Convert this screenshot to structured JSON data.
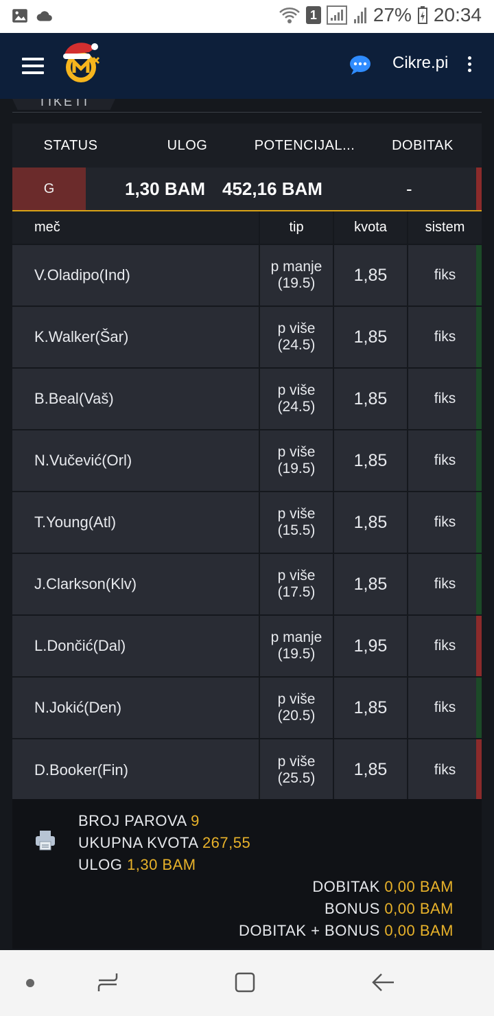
{
  "status_bar": {
    "battery": "27%",
    "time": "20:34",
    "sim_badge": "1"
  },
  "header": {
    "username": "Cikre.pi",
    "icons": [
      "menu-icon",
      "logo",
      "chat-icon",
      "more-vert-icon"
    ]
  },
  "tab": {
    "label": "TIKETI"
  },
  "ticket_header": {
    "status": "STATUS",
    "ulog": "ULOG",
    "potencijalni": "POTENCIJAL...",
    "dobitak": "DOBITAK"
  },
  "ticket": {
    "status": "G",
    "ulog": "1,30 BAM",
    "potencijalni": "452,16 BAM",
    "dobitak": "-",
    "status_color": "#6b2b2b",
    "accent_color": "#d9a316"
  },
  "columns": {
    "mec": "meč",
    "tip": "tip",
    "kvota": "kvota",
    "sistem": "sistem"
  },
  "matches": [
    {
      "mec": "V.Oladipo(Ind)",
      "tip1": "p manje",
      "tip2": "(19.5)",
      "kvota": "1,85",
      "sistem": "fiks",
      "result": "green"
    },
    {
      "mec": "K.Walker(Šar)",
      "tip1": "p više",
      "tip2": "(24.5)",
      "kvota": "1,85",
      "sistem": "fiks",
      "result": "green"
    },
    {
      "mec": "B.Beal(Vaš)",
      "tip1": "p više",
      "tip2": "(24.5)",
      "kvota": "1,85",
      "sistem": "fiks",
      "result": "green"
    },
    {
      "mec": "N.Vučević(Orl)",
      "tip1": "p više",
      "tip2": "(19.5)",
      "kvota": "1,85",
      "sistem": "fiks",
      "result": "green"
    },
    {
      "mec": "T.Young(Atl)",
      "tip1": "p više",
      "tip2": "(15.5)",
      "kvota": "1,85",
      "sistem": "fiks",
      "result": "green"
    },
    {
      "mec": "J.Clarkson(Klv)",
      "tip1": "p više",
      "tip2": "(17.5)",
      "kvota": "1,85",
      "sistem": "fiks",
      "result": "green"
    },
    {
      "mec": "L.Dončić(Dal)",
      "tip1": "p manje",
      "tip2": "(19.5)",
      "kvota": "1,95",
      "sistem": "fiks",
      "result": "red"
    },
    {
      "mec": "N.Jokić(Den)",
      "tip1": "p više",
      "tip2": "(20.5)",
      "kvota": "1,85",
      "sistem": "fiks",
      "result": "green"
    },
    {
      "mec": "D.Booker(Fin)",
      "tip1": "p više",
      "tip2": "(25.5)",
      "kvota": "1,85",
      "sistem": "fiks",
      "result": "red"
    }
  ],
  "summary": {
    "broj_parova_label": "BROJ PAROVA",
    "broj_parova": "9",
    "ukupna_kvota_label": "UKUPNA KVOTA",
    "ukupna_kvota": "267,55",
    "ulog_label": "ULOG",
    "ulog": "1,30 BAM",
    "dobitak_label": "DOBITAK",
    "dobitak": "0,00 BAM",
    "bonus_label": "BONUS",
    "bonus": "0,00 BAM",
    "dobitak_bonus_label": "DOBITAK + BONUS",
    "dobitak_bonus": "0,00 BAM"
  },
  "colors": {
    "header_bg": "#0d1f3a",
    "accent": "#e8b22a",
    "win": "#1c4a28",
    "loss": "#8b2b2b"
  }
}
